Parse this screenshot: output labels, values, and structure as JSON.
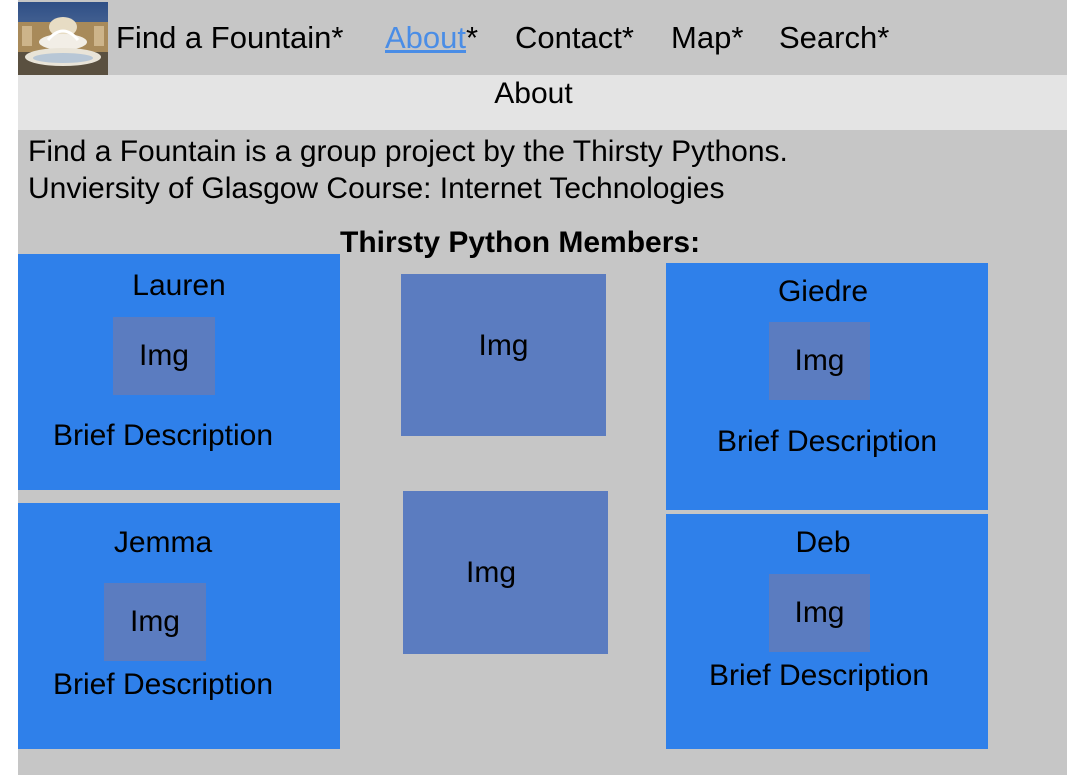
{
  "nav": {
    "logo_icon": "fountain-photo",
    "items": [
      {
        "label": "Find a Fountain",
        "suffix": "*"
      },
      {
        "label": "About",
        "suffix": "*"
      },
      {
        "label": "Contact",
        "suffix": "*"
      },
      {
        "label": "Map",
        "suffix": "*"
      },
      {
        "label": "Search",
        "suffix": "*"
      }
    ],
    "active_color": "#4a8de6"
  },
  "page": {
    "heading": "About",
    "intro_line1": "Find a Fountain is a group project by the Thirsty Pythons.",
    "intro_line2": "Unviersity of Glasgow Course: Internet Technologies",
    "members_title": "Thirsty Python Members:"
  },
  "members": [
    {
      "name": "Lauren",
      "img": "Img",
      "desc": "Brief Description"
    },
    {
      "name": "Giedre",
      "img": "Img",
      "desc": "Brief Description"
    },
    {
      "name": "Jemma",
      "img": "Img",
      "desc": "Brief Description"
    },
    {
      "name": "Deb",
      "img": "Img",
      "desc": "Brief Description"
    }
  ],
  "placeholders": [
    {
      "img": "Img"
    },
    {
      "img": "Img"
    }
  ],
  "colors": {
    "card": "#2f80ea",
    "image_placeholder": "#5b7cc0",
    "nav_bg": "#c6c6c6",
    "subbar_bg": "#e4e4e4"
  }
}
